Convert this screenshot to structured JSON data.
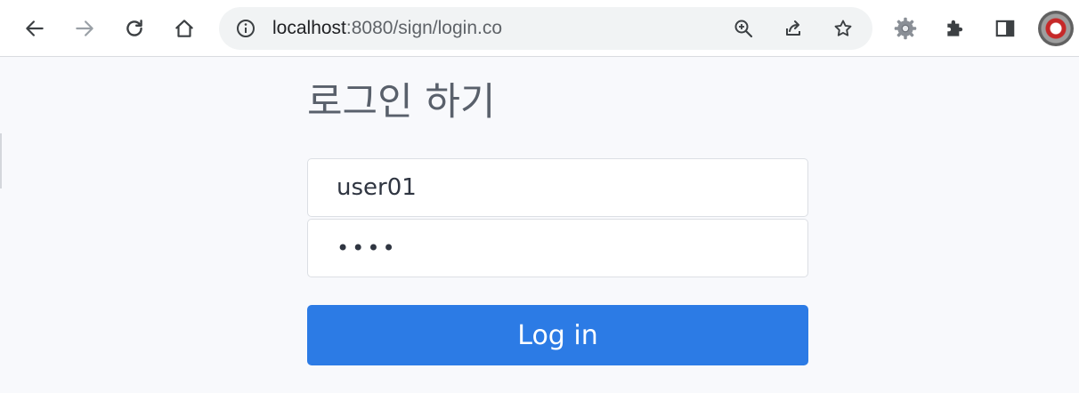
{
  "browser": {
    "url_host": "localhost",
    "url_path": ":8080/sign/login.co",
    "icons": {
      "back": "back-arrow-icon",
      "forward": "forward-arrow-icon",
      "reload": "reload-icon",
      "home": "home-icon",
      "site_info": "info-icon",
      "zoom": "zoom-in-icon",
      "share": "share-icon",
      "bookmark": "star-icon",
      "extension_gear": "gear-icon",
      "extensions": "puzzle-icon",
      "side_panel": "side-panel-icon",
      "profile": "avatar"
    }
  },
  "login": {
    "title": "로그인 하기",
    "username_value": "user01",
    "password_value": "••••",
    "submit_label": "Log in",
    "button_color": "#2c7be5"
  }
}
